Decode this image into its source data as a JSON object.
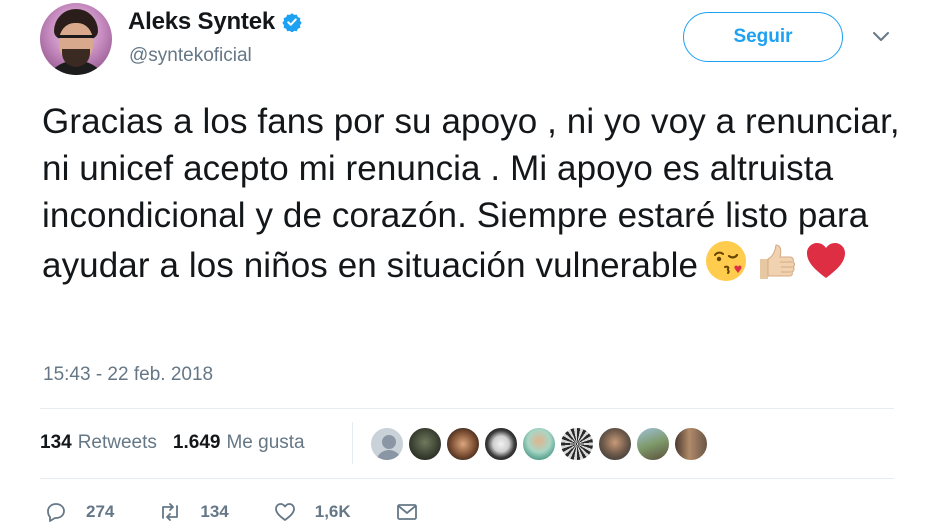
{
  "user": {
    "display_name": "Aleks Syntek",
    "handle": "@syntekoficial",
    "verified": true
  },
  "header": {
    "follow_label": "Seguir"
  },
  "tweet": {
    "text": "Gracias a los fans por su apoyo , ni yo voy a renunciar, ni unicef acepto mi renuncia . Mi apoyo es altruista incondicional y de corazón. Siempre estaré listo para ayudar a los niños en situación vulnerable",
    "emojis": [
      "kissing-face-icon",
      "thumbs-up-icon",
      "red-heart-icon"
    ],
    "timestamp": "15:43 - 22 feb. 2018"
  },
  "stats": {
    "retweets_count": "134",
    "retweets_label": "Retweets",
    "likes_count": "1.649",
    "likes_label": "Me gusta"
  },
  "likers": [
    "liker-avatar-1",
    "liker-avatar-2",
    "liker-avatar-3",
    "liker-avatar-4",
    "liker-avatar-5",
    "liker-avatar-6",
    "liker-avatar-7",
    "liker-avatar-8",
    "liker-avatar-9"
  ],
  "actions": {
    "reply_count": "274",
    "retweet_count": "134",
    "like_count": "1,6K"
  },
  "colors": {
    "accent": "#1da1f2",
    "text": "#14171a",
    "secondary": "#657786",
    "divider": "#e6ecf0",
    "heart": "#dd2e44"
  }
}
